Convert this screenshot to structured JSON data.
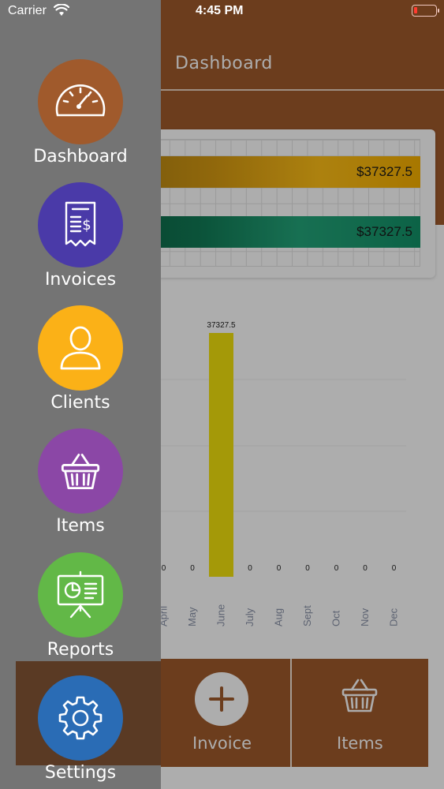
{
  "status_bar": {
    "carrier": "Carrier",
    "time": "4:45 PM"
  },
  "header": {
    "title": "Dashboard"
  },
  "summary": [
    {
      "amount": "$37327.5",
      "color": "#ffbf17"
    },
    {
      "amount": "$37327.5",
      "color": "#139268"
    }
  ],
  "chart_data": {
    "type": "bar",
    "categories": [
      "April",
      "May",
      "June",
      "July",
      "Aug",
      "Sept",
      "Oct",
      "Nov",
      "Dec"
    ],
    "values": [
      0,
      0,
      37327.5,
      0,
      0,
      0,
      0,
      0,
      0
    ],
    "value_labels": [
      "0",
      "0",
      "37327.5",
      "0",
      "0",
      "0",
      "0",
      "0",
      "0"
    ],
    "bar_color": "#f2e20c",
    "ylim": [
      0,
      37327.5
    ],
    "grid": true
  },
  "actions": {
    "invoice_label": "Invoice",
    "items_label": "Items"
  },
  "menu": {
    "items": [
      {
        "label": "Dashboard",
        "icon": "speedometer-icon",
        "color": "#a05a2c"
      },
      {
        "label": "Invoices",
        "icon": "receipt-icon",
        "color": "#4a3aa8"
      },
      {
        "label": "Clients",
        "icon": "user-icon",
        "color": "#fbb117"
      },
      {
        "label": "Items",
        "icon": "basket-icon",
        "color": "#8b47a6"
      },
      {
        "label": "Reports",
        "icon": "presentation-board-icon",
        "color": "#62b847"
      },
      {
        "label": "Settings",
        "icon": "gear-icon",
        "color": "#2a6cb5"
      }
    ]
  }
}
